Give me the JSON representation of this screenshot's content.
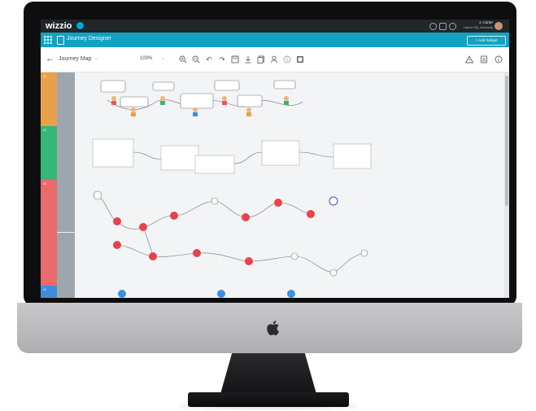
{
  "app": {
    "brand": "wizzio",
    "title": "Journey Designer",
    "add_widget": "Add Widget"
  },
  "user": {
    "name": "J. Carter",
    "org": "Lutton HQ, Kennedy"
  },
  "toolbar": {
    "map_name": "Journey Map",
    "zoom": "100%"
  },
  "icons": [
    "back-arrow-icon",
    "zoom-in-icon",
    "zoom-out-icon",
    "undo-icon",
    "redo-icon",
    "save-icon",
    "download-icon",
    "copy-icon",
    "person-icon",
    "info-icon",
    "image-icon",
    "warning-icon",
    "notes-icon",
    "info-circle-icon",
    "grid-icon",
    "search-icon",
    "phone-icon",
    "bell-icon"
  ],
  "colors": {
    "topbar": "#21262b",
    "accent": "#11a3c1",
    "stage1": "#e9a04c",
    "stage2": "#36b677",
    "stage3": "#ea6b6b",
    "stage4": "#3d8fde",
    "node": "#e8434a"
  },
  "lanes": [
    {
      "num": "01",
      "color": "#e9a04c"
    },
    {
      "num": "02",
      "color": "#36b677"
    },
    {
      "num": "03",
      "color": "#ea6b6b"
    },
    {
      "num": "04",
      "color": "#3d8fde"
    }
  ]
}
